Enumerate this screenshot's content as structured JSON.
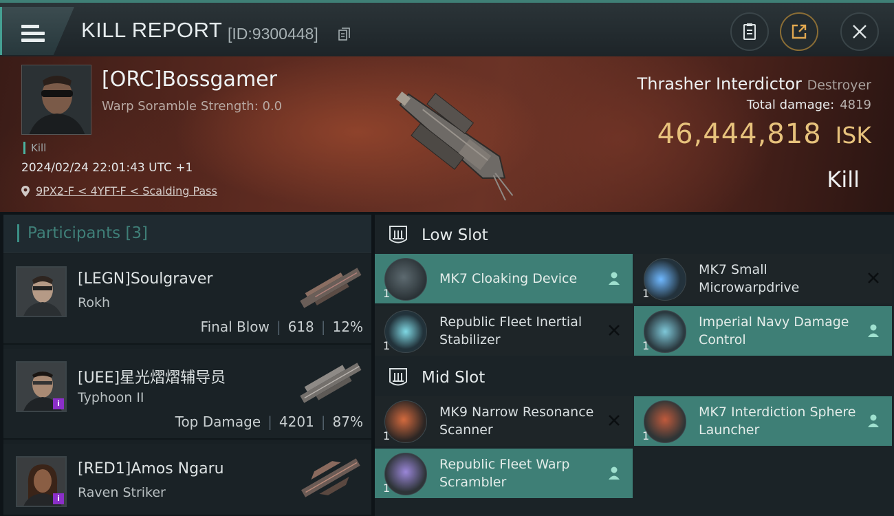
{
  "header": {
    "title": "KILL REPORT",
    "report_id": "[ID:9300448]"
  },
  "victim": {
    "name": "[ORC]Bossgamer",
    "scramble_strength": "Warp Soramble Strength: 0.0",
    "tag": "Kill",
    "datetime": "2024/02/24 22:01:43 UTC +1",
    "location": "9PX2-F < 4YFT-F < Scalding Pass",
    "ship_name": "Thrasher Interdictor",
    "ship_class": "Destroyer",
    "total_damage_label": "Total damage:",
    "total_damage": "4819",
    "isk_value": "46,444,818",
    "isk_unit": "ISK",
    "result": "Kill"
  },
  "participants": {
    "label": "Participants [3]",
    "rows": [
      {
        "name": "[LEGN]Soulgraver",
        "ship": "Rokh",
        "role": "Final Blow",
        "damage": "618",
        "percent": "12%"
      },
      {
        "name": "[UEE]星光熠熠辅导员",
        "ship": "Typhoon II",
        "role": "Top Damage",
        "damage": "4201",
        "percent": "87%"
      },
      {
        "name": "[RED1]Amos Ngaru",
        "ship": "Raven Striker",
        "role": "",
        "damage": "",
        "percent": ""
      }
    ]
  },
  "fitting": {
    "low_slot_label": "Low Slot",
    "mid_slot_label": "Mid Slot",
    "low": [
      {
        "name": "MK7 Cloaking Device",
        "qty": "1",
        "status": "dropped"
      },
      {
        "name": "MK7 Small Microwarpdrive",
        "qty": "1",
        "status": "destroyed"
      },
      {
        "name": "Republic Fleet Inertial Stabilizer",
        "qty": "1",
        "status": "destroyed"
      },
      {
        "name": "Imperial Navy Damage Control",
        "qty": "1",
        "status": "dropped"
      }
    ],
    "mid": [
      {
        "name": "MK9 Narrow Resonance Scanner",
        "qty": "1",
        "status": "destroyed"
      },
      {
        "name": "MK7 Interdiction Sphere Launcher",
        "qty": "1",
        "status": "dropped"
      },
      {
        "name": "Republic Fleet Warp Scrambler",
        "qty": "1",
        "status": "dropped"
      }
    ]
  },
  "colors": {
    "accent": "#3e7f76",
    "isk": "#e7c27c",
    "destroyed_bg": "#1e2528"
  },
  "icons": [
    "menu-icon",
    "copy-icon",
    "clipboard-icon",
    "share-icon",
    "close-icon",
    "location-pin-icon",
    "low-slot-icon",
    "mid-slot-icon",
    "person-icon",
    "x-icon"
  ]
}
